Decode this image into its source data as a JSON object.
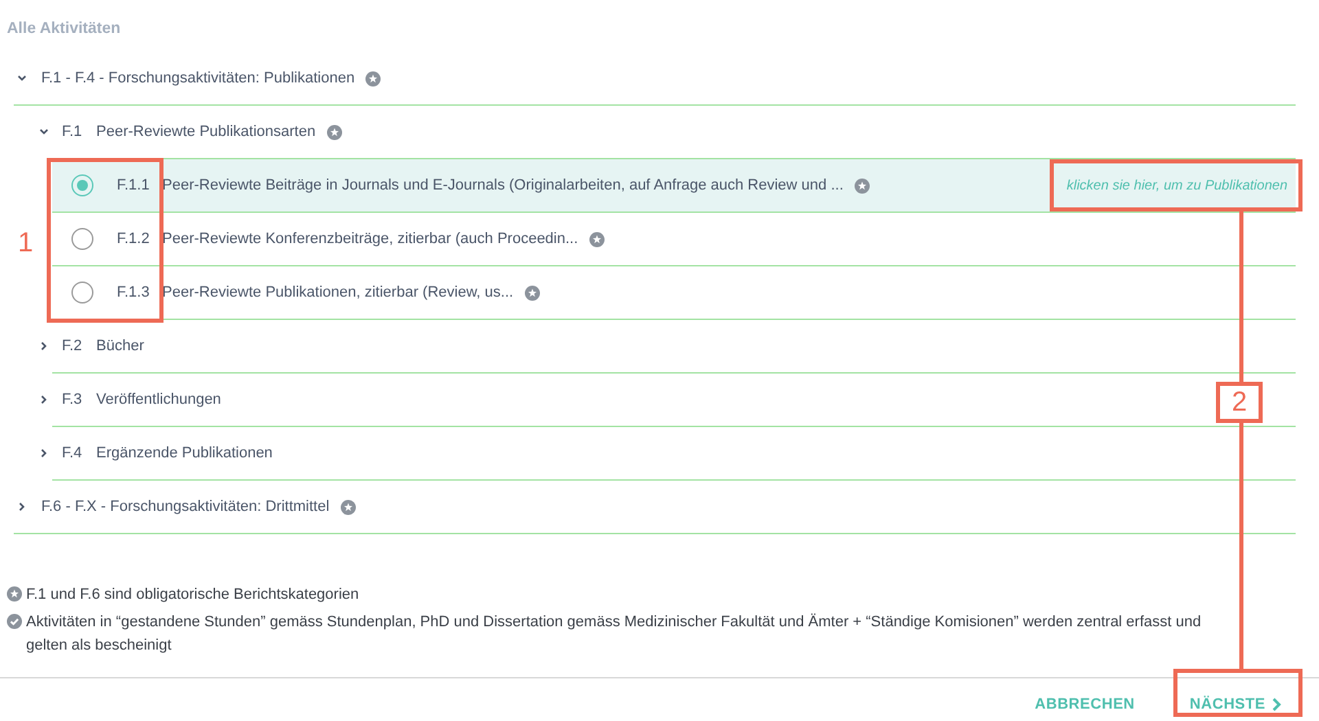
{
  "title": "Alle Aktivitäten",
  "tree": [
    {
      "kind": "category",
      "label": "F.1 - F.4 - Forschungsaktivitäten: Publikationen",
      "starred": true,
      "expanded": true,
      "children": [
        {
          "kind": "category",
          "code": "F.1",
          "label": "Peer-Reviewte Publikationsarten",
          "starred": true,
          "expanded": true,
          "children": [
            {
              "kind": "option",
              "code": "F.1.1",
              "label": "Peer-Reviewte Beiträge in Journals und E-Journals (Originalarbeiten, auf Anfrage auch Review und ...",
              "starred": true,
              "selected": true,
              "link": "klicken sie hier, um zu Publikationen"
            },
            {
              "kind": "option",
              "code": "F.1.2",
              "label": "Peer-Reviewte Konferenzbeiträge, zitierbar (auch Proceedin...",
              "starred": true,
              "selected": false
            },
            {
              "kind": "option",
              "code": "F.1.3",
              "label": "Peer-Reviewte Publikationen, zitierbar (Review, us...",
              "starred": true,
              "selected": false
            }
          ]
        },
        {
          "kind": "category",
          "code": "F.2",
          "label": "Bücher",
          "starred": false,
          "expanded": false
        },
        {
          "kind": "category",
          "code": "F.3",
          "label": "Veröffentlichungen",
          "starred": false,
          "expanded": false
        },
        {
          "kind": "category",
          "code": "F.4",
          "label": "Ergänzende Publikationen",
          "starred": false,
          "expanded": false
        }
      ]
    },
    {
      "kind": "category",
      "label": "F.6 - F.X - Forschungsaktivitäten: Drittmittel",
      "starred": true,
      "expanded": false
    }
  ],
  "notes": [
    {
      "kind": "mandatory",
      "text": "F.1 und F.6 sind obligatorische Berichtskategorien"
    },
    {
      "kind": "verified",
      "text": "Aktivitäten in “gestandene Stunden” gemäss Stundenplan, PhD und Dissertation gemäss Medizinischer Fakultät und Ämter + “Ständige Komisionen” werden zentral erfasst und gelten als bescheinigt"
    }
  ],
  "buttons": {
    "cancel": "ABBRECHEN",
    "next": "NÄCHSTE"
  },
  "callouts": [
    {
      "label": "1"
    },
    {
      "label": "2"
    }
  ]
}
